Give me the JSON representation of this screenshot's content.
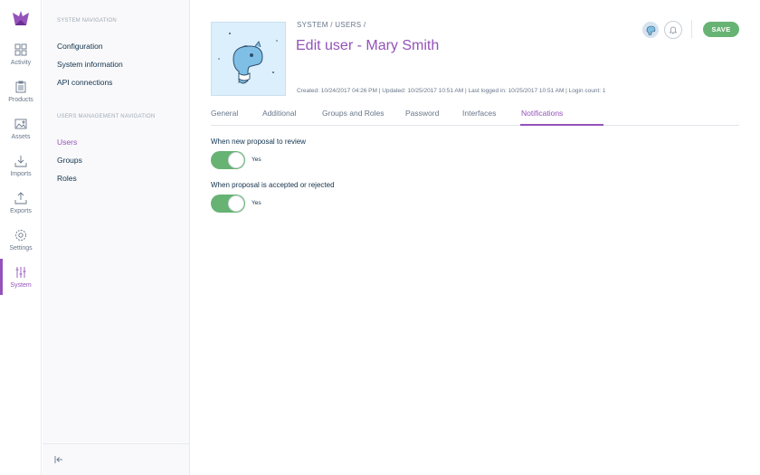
{
  "colors": {
    "accent": "#9452ba",
    "success": "#67b373",
    "text": "#11324d",
    "muted": "#67768a"
  },
  "menu": {
    "logo_icon": "akeneo-logo-icon",
    "items": [
      {
        "label": "Activity",
        "icon": "activity-icon"
      },
      {
        "label": "Products",
        "icon": "products-icon"
      },
      {
        "label": "Assets",
        "icon": "assets-icon"
      },
      {
        "label": "Imports",
        "icon": "imports-icon"
      },
      {
        "label": "Exports",
        "icon": "exports-icon"
      },
      {
        "label": "Settings",
        "icon": "settings-icon"
      },
      {
        "label": "System",
        "icon": "system-icon",
        "active": true
      }
    ]
  },
  "nav": {
    "system_title": "SYSTEM NAVIGATION",
    "system_links": [
      "Configuration",
      "System information",
      "API connections"
    ],
    "users_title": "USERS MANAGEMENT NAVIGATION",
    "users_links": [
      "Users",
      "Groups",
      "Roles"
    ],
    "active_link": "Users",
    "collapse_icon": "collapse-icon"
  },
  "header": {
    "breadcrumb": "SYSTEM / USERS /",
    "title": "Edit user - Mary Smith",
    "meta": "Created: 10/24/2017 04:26 PM | Updated: 10/25/2017 10:51 AM | Last logged in: 10/25/2017 10:51 AM | Login count: 1",
    "save_label": "SAVE"
  },
  "tabs": {
    "items": [
      "General",
      "Additional",
      "Groups and Roles",
      "Password",
      "Interfaces",
      "Notifications"
    ],
    "active": "Notifications"
  },
  "notifications": [
    {
      "label": "When new proposal to review",
      "value": "Yes",
      "checked": true
    },
    {
      "label": "When proposal is accepted or rejected",
      "value": "Yes",
      "checked": true
    }
  ]
}
